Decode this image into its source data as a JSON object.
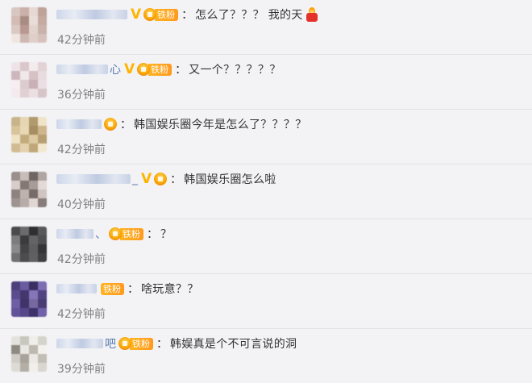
{
  "comments": [
    {
      "name_suffix": "",
      "has_vip": true,
      "fan_label": "铁粉",
      "text": "怎么了？？？ 我的天",
      "has_fire_emoji": true,
      "time": "42分钟前",
      "avatar_colors": [
        "#d8c6c0",
        "#c9b0a8",
        "#e6d8d2",
        "#bfa39a",
        "#d2bcb4",
        "#a88c84",
        "#e8ddd8",
        "#c4aaa2",
        "#dac9c2",
        "#b89890",
        "#e2d3cd",
        "#c8b2ab",
        "#efe6e2",
        "#cdb9b2",
        "#e0cfc9",
        "#d5c2bb"
      ]
    },
    {
      "name_suffix": "心",
      "has_vip": true,
      "fan_label": "铁粉",
      "text": "又一个？？？？？",
      "has_fire_emoji": false,
      "time": "36分钟前",
      "avatar_colors": [
        "#eee4e7",
        "#d9c7cc",
        "#f3ecee",
        "#e2d2d6",
        "#cdb7bd",
        "#f0e8ea",
        "#d5c1c6",
        "#e8dcdf",
        "#f5eff1",
        "#dccbcf",
        "#c8b0b6",
        "#eadfe2",
        "#f2eaec",
        "#e0d0d4",
        "#ecdfe2",
        "#d6c4c9"
      ]
    },
    {
      "name_suffix": "",
      "has_vip": false,
      "fan_label": "",
      "text": "韩国娱乐圈今年是怎么了？？？？",
      "has_fire_emoji": false,
      "time": "42分钟前",
      "avatar_colors": [
        "#c8b48a",
        "#e6d6b4",
        "#b09a6e",
        "#f0e4c8",
        "#d9c39a",
        "#e8d8b6",
        "#a68e62",
        "#cdb68c",
        "#efe3c6",
        "#c3ab7e",
        "#ddc9a2",
        "#b79f72",
        "#d0bb92",
        "#e4d2ae",
        "#bfa77a",
        "#f2e8d0"
      ]
    },
    {
      "name_suffix": "_",
      "has_vip": true,
      "fan_label": "",
      "text": "韩国娱乐圈怎么啦",
      "has_fire_emoji": false,
      "time": "40分钟前",
      "avatar_colors": [
        "#9a8f8c",
        "#c9bdb9",
        "#6f6562",
        "#b1a5a1",
        "#d8cdca",
        "#837875",
        "#a89c98",
        "#e3d9d6",
        "#8d827f",
        "#bfb3af",
        "#766b68",
        "#cfc4c0",
        "#9f9490",
        "#b8aca8",
        "#e0d6d3",
        "#877c79"
      ]
    },
    {
      "name_suffix": "、",
      "has_vip": false,
      "fan_label": "铁粉",
      "text": "？",
      "has_fire_emoji": false,
      "time": "42分钟前",
      "avatar_colors": [
        "#4a4a4c",
        "#6b6b6e",
        "#2f2f31",
        "#58585b",
        "#7c7c80",
        "#3b3b3d",
        "#646467",
        "#4f4f52",
        "#8a8a8e",
        "#444447",
        "#5e5e61",
        "#353537",
        "#707073",
        "#4c4c4f",
        "#606063",
        "#3f3f42"
      ]
    },
    {
      "name_suffix": "",
      "has_vip": false,
      "fan_label": "铁粉",
      "text": "啥玩意？？",
      "has_fire_emoji": false,
      "time": "42分钟前",
      "avatar_colors": [
        "#4d3f7a",
        "#6a5aa0",
        "#3a2f63",
        "#7d6db3",
        "#5b4c8e",
        "#43376e",
        "#8576b8",
        "#524482",
        "#6e5fa5",
        "#3f3369",
        "#77689f",
        "#4a3d76",
        "#625398",
        "#55478a",
        "#3c316a",
        "#6f62a8"
      ]
    },
    {
      "name_suffix": "吧",
      "has_vip": false,
      "fan_label": "铁粉",
      "text": "韩娱真是个不可言说的洞",
      "has_fire_emoji": false,
      "time": "39分钟前",
      "avatar_colors": [
        "#e4e2dc",
        "#c9c6be",
        "#f0eee9",
        "#d6d3cc",
        "#8e8a82",
        "#e9e7e2",
        "#bdb9b0",
        "#f3f1ed",
        "#d0cdc6",
        "#a7a39a",
        "#ebe9e4",
        "#c2beb6",
        "#dedbd5",
        "#b3afa6",
        "#f1efeb",
        "#d9d6cf"
      ]
    }
  ]
}
